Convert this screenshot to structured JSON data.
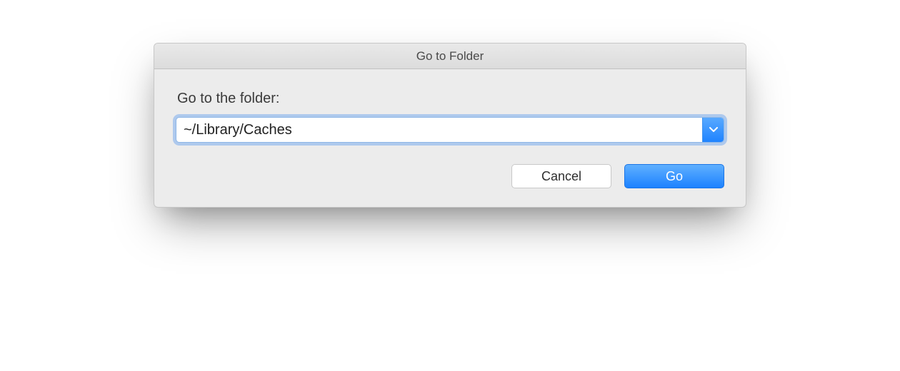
{
  "dialog": {
    "title": "Go to Folder",
    "prompt_label": "Go to the folder:",
    "path_value": "~/Library/Caches",
    "cancel_label": "Cancel",
    "go_label": "Go"
  }
}
